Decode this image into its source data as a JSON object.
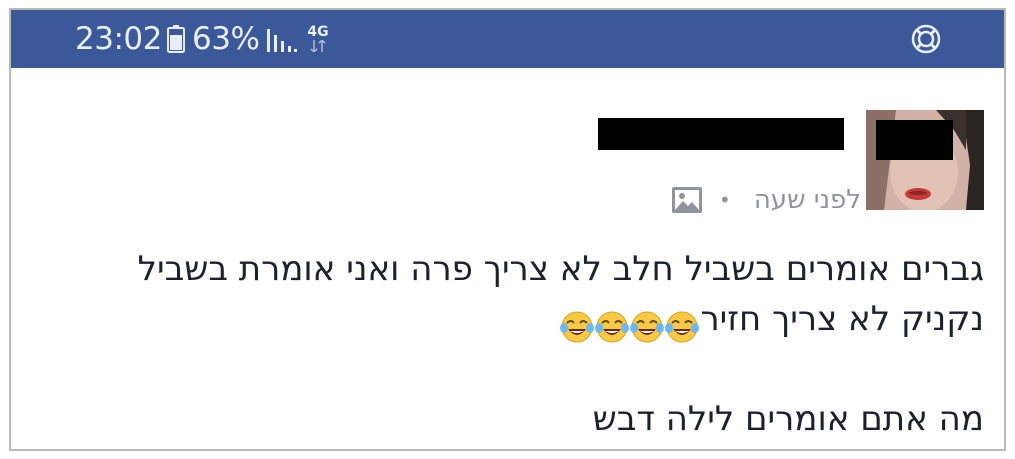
{
  "status_bar": {
    "time": "23:02",
    "battery_percent": "63%",
    "network_type": "4G",
    "background_color": "#3b5998",
    "icons": [
      "battery-icon",
      "signal-icon",
      "network-arrows-icon",
      "lifebuoy-icon"
    ]
  },
  "post": {
    "timestamp": "לפני שעה",
    "separator": "•",
    "audience_icon": "photo-icon",
    "body_lines": [
      "גברים אומרים בשביל חלב לא צריך פרה ואני אומרת בשביל",
      "נקניק לא צריך חזיר",
      "",
      "מה אתם אומרים לילה דבש"
    ],
    "emoji": [
      "face-with-tears-of-joy",
      "face-with-tears-of-joy",
      "face-with-tears-of-joy",
      "face-with-tears-of-joy"
    ]
  }
}
